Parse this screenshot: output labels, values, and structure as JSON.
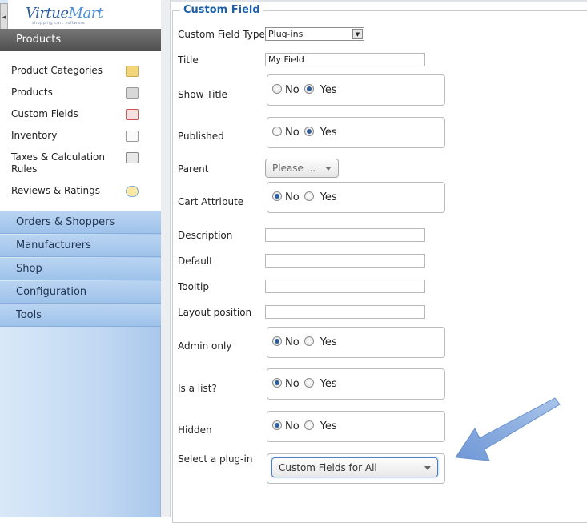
{
  "sidebar": {
    "collapse_glyph": "◂",
    "logo": {
      "virtue": "Virtue",
      "mart": "Mart",
      "tagline": "shopping cart software"
    },
    "section_header": "Products",
    "sub_items": [
      {
        "label": "Product Categories",
        "icon": "folder-icon"
      },
      {
        "label": "Products",
        "icon": "camera-icon"
      },
      {
        "label": "Custom Fields",
        "icon": "custom-fields-icon"
      },
      {
        "label": "Inventory",
        "icon": "chart-icon"
      },
      {
        "label": "Taxes & Calculation Rules",
        "icon": "calculator-icon"
      },
      {
        "label": "Reviews & Ratings",
        "icon": "speech-bubble-icon"
      }
    ],
    "nav_buttons": [
      "Orders & Shoppers",
      "Manufacturers",
      "Shop",
      "Configuration",
      "Tools"
    ]
  },
  "form": {
    "legend": "Custom Field",
    "custom_field_type": {
      "label": "Custom Field Type:",
      "value": "Plug-ins"
    },
    "title": {
      "label": "Title",
      "value": "My Field"
    },
    "show_title": {
      "label": "Show Title",
      "no": "No",
      "yes": "Yes",
      "selected": "Yes"
    },
    "published": {
      "label": "Published",
      "no": "No",
      "yes": "Yes",
      "selected": "Yes"
    },
    "parent": {
      "label": "Parent",
      "value": "Please ..."
    },
    "cart_attribute": {
      "label": "Cart Attribute",
      "no": "No",
      "yes": "Yes",
      "selected": "No"
    },
    "description": {
      "label": "Description",
      "value": ""
    },
    "default": {
      "label": "Default",
      "value": ""
    },
    "tooltip": {
      "label": "Tooltip",
      "value": ""
    },
    "layout_position": {
      "label": "Layout position",
      "value": ""
    },
    "admin_only": {
      "label": "Admin only",
      "no": "No",
      "yes": "Yes",
      "selected": "No"
    },
    "is_list": {
      "label": "Is a list?",
      "no": "No",
      "yes": "Yes",
      "selected": "No"
    },
    "hidden": {
      "label": "Hidden",
      "no": "No",
      "yes": "Yes",
      "selected": "No"
    },
    "select_plugin": {
      "label": "Select a plug-in",
      "value": "Custom Fields for All"
    }
  },
  "colors": {
    "accent": "#1f5fa6",
    "annotation_arrow": "#7da6dc"
  }
}
